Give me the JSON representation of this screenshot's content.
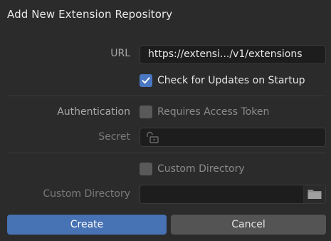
{
  "dialog": {
    "title": "Add New Extension Repository"
  },
  "url": {
    "label": "URL",
    "value": "https://extensi.../v1/extensions"
  },
  "check_updates": {
    "label": "Check for Updates on Startup",
    "checked": true
  },
  "authentication": {
    "label": "Authentication",
    "checkbox_label": "Requires Access Token",
    "checked": false
  },
  "secret": {
    "label": "Secret",
    "value": "",
    "icon": "lock-open-icon"
  },
  "custom_dir": {
    "checkbox_label": "Custom Directory",
    "checked": false,
    "field_label": "Custom Directory",
    "value": "",
    "icon": "folder-icon"
  },
  "buttons": {
    "create": "Create",
    "cancel": "Cancel"
  },
  "colors": {
    "accent": "#4772b3",
    "checkbox_on": "#4a77c2",
    "background": "#2b2b2b"
  }
}
